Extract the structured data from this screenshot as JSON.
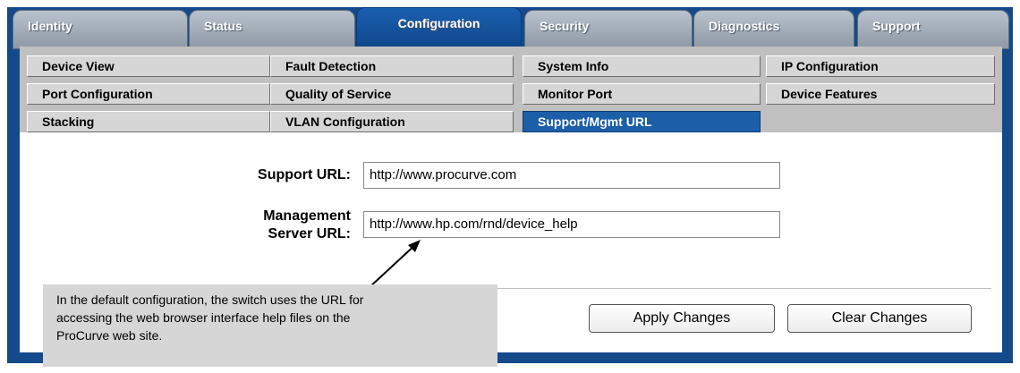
{
  "tabs": [
    {
      "label": "Identity"
    },
    {
      "label": "Status"
    },
    {
      "label": "Configuration"
    },
    {
      "label": "Security"
    },
    {
      "label": "Diagnostics"
    },
    {
      "label": "Support"
    }
  ],
  "active_tab": "Configuration",
  "subnav": [
    {
      "label": "Device View"
    },
    {
      "label": "Fault Detection"
    },
    {
      "label": "System Info"
    },
    {
      "label": "IP Configuration"
    },
    {
      "label": "Port Configuration"
    },
    {
      "label": "Quality of Service"
    },
    {
      "label": "Monitor Port"
    },
    {
      "label": "Device Features"
    },
    {
      "label": "Stacking"
    },
    {
      "label": "VLAN Configuration"
    },
    {
      "label": "Support/Mgmt URL"
    }
  ],
  "active_subnav": "Support/Mgmt URL",
  "form": {
    "support_url_label": "Support URL:",
    "support_url_value": "http://www.procurve.com",
    "mgmt_label_line1": "Management",
    "mgmt_label_line2": "Server URL:",
    "mgmt_url_value": "http://www.hp.com/rnd/device_help"
  },
  "buttons": {
    "apply": "Apply Changes",
    "clear": "Clear Changes"
  },
  "callout": {
    "line1": "In the default configuration, the switch uses the URL for",
    "line2": "accessing the web browser interface help files on the",
    "line3": "ProCurve web site."
  },
  "colors": {
    "frame": "#154a8a",
    "active_tab": "#1a5fb0",
    "subnav_bg": "#c0c0c0",
    "callout_bg": "#d6d6d6"
  }
}
